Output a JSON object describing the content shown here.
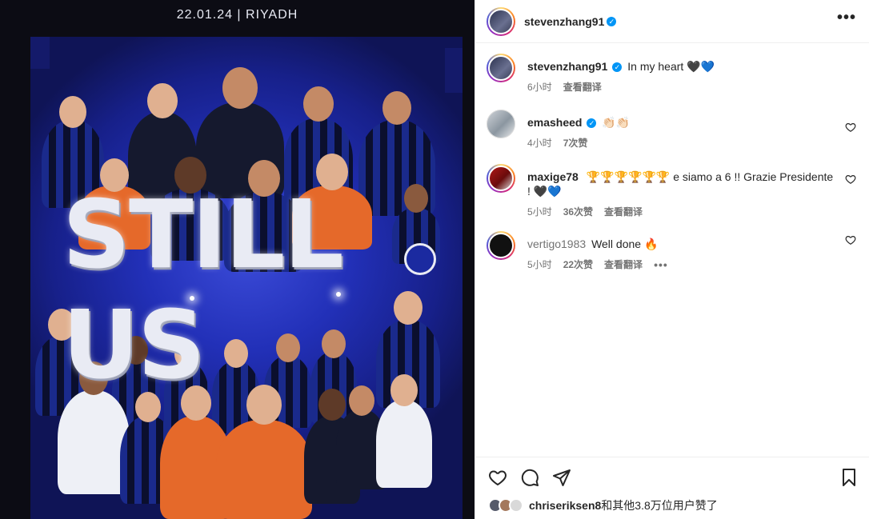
{
  "post_image": {
    "date_line": "22.01.24 | RIYADH",
    "headline": "STILL US",
    "alt": "Inter squad celebration graphic"
  },
  "header": {
    "username": "stevenzhang91",
    "verified": true,
    "more_label": "•••"
  },
  "comments": [
    {
      "username": "stevenzhang91",
      "verified": true,
      "text": "In my heart 🖤💙",
      "time": "6小时",
      "likes": "",
      "translate": "查看翻译",
      "avatar_style": "story"
    },
    {
      "username": "emasheed",
      "verified": true,
      "text": "👏🏻👏🏻",
      "time": "4小时",
      "likes": "7次赞",
      "translate": "",
      "avatar_style": "light"
    },
    {
      "username": "maxige78",
      "verified": false,
      "text": "🏆🏆🏆🏆🏆🏆 e siamo a 6 !! Grazie Presidente ! 🖤💙",
      "time": "5小时",
      "likes": "36次赞",
      "translate": "查看翻译",
      "avatar_style": "red"
    },
    {
      "username": "vertigo1983",
      "verified": false,
      "text": "Well done 🔥",
      "time": "5小时",
      "likes": "22次赞",
      "translate": "查看翻译",
      "more": "•••",
      "avatar_style": "black"
    }
  ],
  "likes_summary": {
    "first_user": "chriseriksen8",
    "rest": "和其他3.8万位用户赞了"
  },
  "colors": {
    "verified": "#0095f6",
    "meta_text": "#737373",
    "border": "#efefef",
    "inter_blue": "#1b2aa0"
  },
  "icons": {
    "like": "heart-icon",
    "comment": "comment-icon",
    "share": "share-icon",
    "save": "bookmark-icon",
    "more": "more-options-icon"
  }
}
